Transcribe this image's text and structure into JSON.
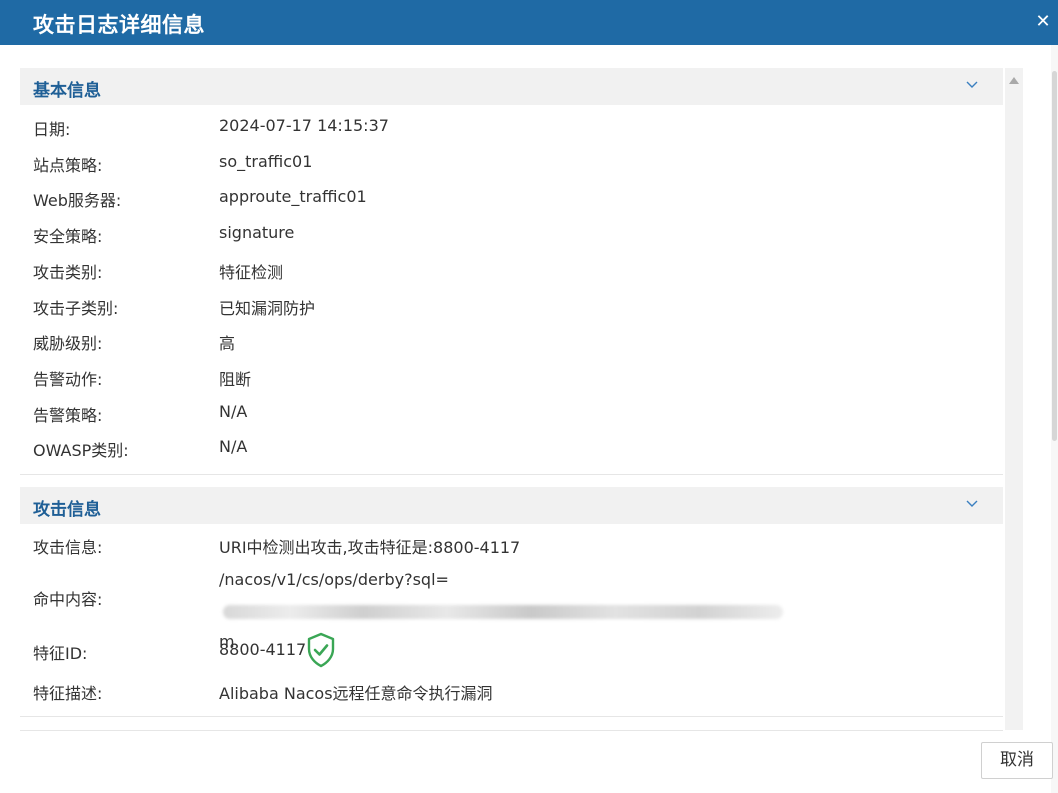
{
  "dialog": {
    "title": "攻击日志详细信息",
    "close_icon": "close-icon",
    "cancel_label": "取消"
  },
  "basic": {
    "title": "基本信息",
    "rows": [
      {
        "label": "日期:",
        "value": "2024-07-17 14:15:37"
      },
      {
        "label": "站点策略:",
        "value": "so_traffic01"
      },
      {
        "label": "Web服务器:",
        "value": "approute_traffic01"
      },
      {
        "label": "安全策略:",
        "value": "signature"
      },
      {
        "label": "攻击类别:",
        "value": "特征检测"
      },
      {
        "label": "攻击子类别:",
        "value": "已知漏洞防护"
      },
      {
        "label": "威胁级别:",
        "value": "高"
      },
      {
        "label": "告警动作:",
        "value": "阻断"
      },
      {
        "label": "告警策略:",
        "value": "N/A"
      },
      {
        "label": "OWASP类别:",
        "value": "N/A"
      }
    ]
  },
  "attack": {
    "title": "攻击信息",
    "info_label": "攻击信息:",
    "info_value": "URI中检测出攻击,攻击特征是:8800-4117",
    "hit_label": "命中内容:",
    "hit_value_prefix": "/nacos/v1/cs/ops/derby?sql=",
    "hit_value_suffix": "m",
    "sig_label": "特征ID:",
    "sig_value": "8800-4117",
    "sig_icon": "shield-check-icon",
    "desc_label": "特征描述:",
    "desc_value": "Alibaba Nacos远程任意命令执行漏洞"
  },
  "colors": {
    "header_bg": "#1f6aa5",
    "section_title": "#1f5f96",
    "shield_green": "#3aa655"
  }
}
